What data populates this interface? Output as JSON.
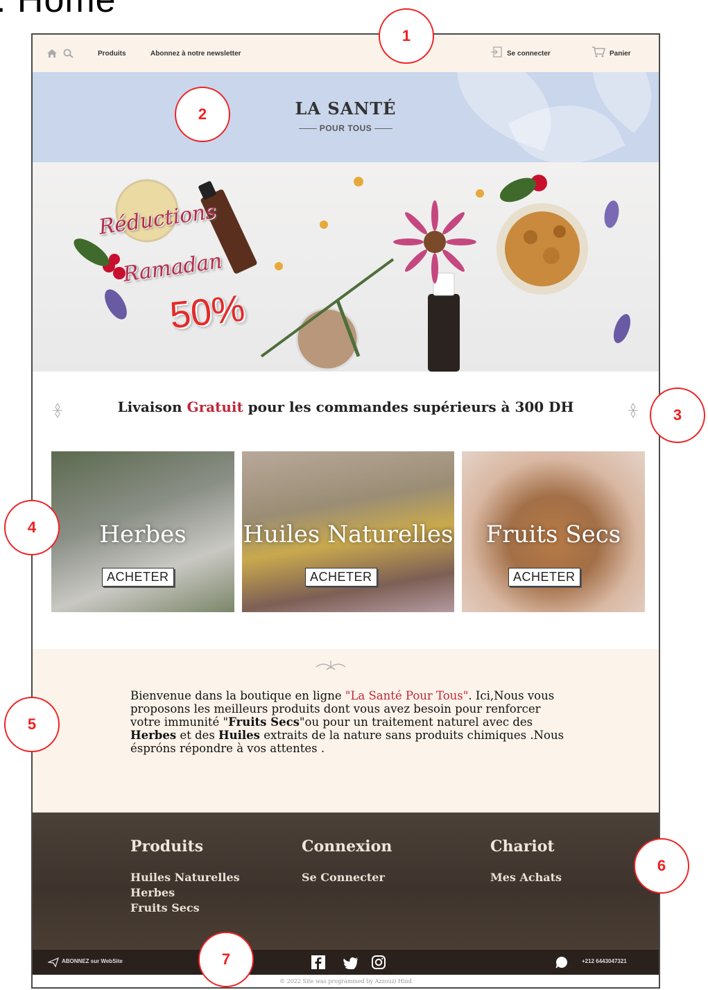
{
  "page_heading": ": Home",
  "nav": {
    "products": "Produits",
    "newsletter": "Abonnez à notre newsletter",
    "login": "Se connecter",
    "cart": "Panier"
  },
  "brand": {
    "title": "LA SANTÉ",
    "subtitle": "POUR TOUS"
  },
  "hero": {
    "promo_line1": "Réductions",
    "promo_line2": "Ramadan",
    "promo_percent": "50%"
  },
  "delivery": {
    "before": "Livaison ",
    "highlight": "Gratuit",
    "after": " pour les commandes supérieurs à 300 DH"
  },
  "categories": [
    {
      "name": "Herbes",
      "button": "ACHETER"
    },
    {
      "name": "Huiles Naturelles",
      "button": "ACHETER"
    },
    {
      "name": "Fruits Secs",
      "button": "ACHETER"
    }
  ],
  "welcome": {
    "p1": "Bienvenue dans la boutique en ligne ",
    "p1_highlight": "\"La Santé Pour Tous\"",
    "p2": ". Ici,Nous vous proposons les meilleurs produits dont vous avez besoin pour renforcer votre immunité \"",
    "p2_bold": "Fruits Secs",
    "p3": "\"ou pour un traitement naturel avec des ",
    "p3_bold1": "Herbes",
    "p4": " et des ",
    "p4_bold2": "Huiles",
    "p5": " extraits de la nature sans produits chimiques .Nous éspróns répondre à vos attentes ."
  },
  "footer": {
    "col1_title": "Produits",
    "col1_links": [
      "Huiles Naturelles",
      "Herbes",
      "Fruits Secs"
    ],
    "col2_title": "Connexion",
    "col2_links": [
      "Se Connecter"
    ],
    "col3_title": "Chariot",
    "col3_links": [
      "Mes Achats"
    ]
  },
  "bottom_bar": {
    "subscribe": "ABONNEZ sur WebSite",
    "phone": "+212 6443047321"
  },
  "copyright": "© 2022 Site was programmed by Azzouzi Hind",
  "markers": [
    "1",
    "2",
    "3",
    "4",
    "5",
    "6",
    "7"
  ],
  "colors": {
    "nav_bg": "#fbf3ea",
    "banner_bg": "#c9d6ec",
    "accent_red": "#c0263a",
    "footer_bg": "#3e342d",
    "marker": "#e22222"
  }
}
